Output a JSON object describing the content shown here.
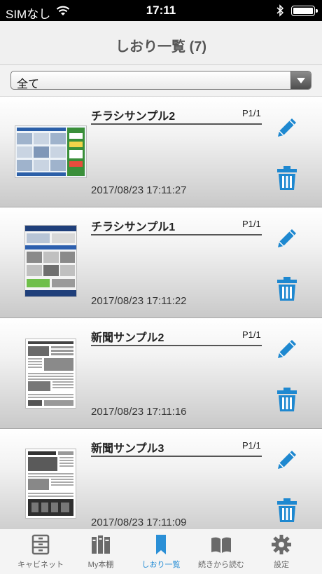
{
  "status_bar": {
    "carrier": "SIMなし",
    "time": "17:11"
  },
  "nav": {
    "title": "しおり一覧 (7)"
  },
  "filter": {
    "selected": "全て"
  },
  "bookmarks": [
    {
      "title": "チラシサンプル2",
      "page": "P1/1",
      "date": "2017/08/23 17:11:27"
    },
    {
      "title": "チラシサンプル1",
      "page": "P1/1",
      "date": "2017/08/23 17:11:22"
    },
    {
      "title": "新聞サンプル2",
      "page": "P1/1",
      "date": "2017/08/23 17:11:16"
    },
    {
      "title": "新聞サンプル3",
      "page": "P1/1",
      "date": "2017/08/23 17:11:09"
    }
  ],
  "tabs": [
    {
      "label": "キャビネット",
      "icon": "cabinet-icon",
      "active": false
    },
    {
      "label": "My本棚",
      "icon": "bookshelf-icon",
      "active": false
    },
    {
      "label": "しおり一覧",
      "icon": "bookmark-icon",
      "active": true
    },
    {
      "label": "続きから読む",
      "icon": "open-book-icon",
      "active": false
    },
    {
      "label": "設定",
      "icon": "gear-icon",
      "active": false
    }
  ],
  "colors": {
    "accent": "#2a8fd6",
    "action_icon": "#1e88d0",
    "tab_inactive": "#6a6a6a"
  }
}
